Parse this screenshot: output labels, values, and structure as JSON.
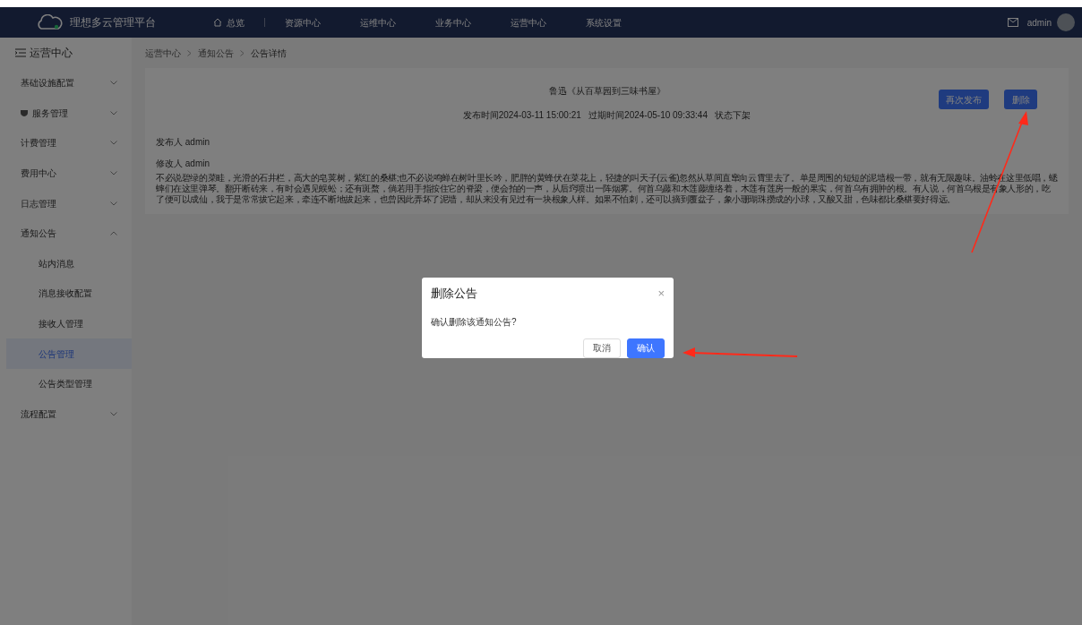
{
  "header": {
    "brand": "理想多云管理平台",
    "nav": [
      {
        "label": "总览",
        "kind": "home"
      },
      {
        "label": "资源中心",
        "kind": "plain"
      },
      {
        "label": "运维中心",
        "kind": "plain"
      },
      {
        "label": "业务中心",
        "kind": "plain"
      },
      {
        "label": "运营中心",
        "kind": "plain"
      },
      {
        "label": "系统设置",
        "kind": "plain"
      }
    ],
    "user": "admin"
  },
  "sidebar": {
    "title": "运营中心",
    "items": [
      {
        "label": "基础设施配置",
        "expanded": false
      },
      {
        "label": "服务管理",
        "expanded": false
      },
      {
        "label": "计费管理",
        "expanded": false
      },
      {
        "label": "费用中心",
        "expanded": false
      },
      {
        "label": "日志管理",
        "expanded": false
      },
      {
        "label": "通知公告",
        "expanded": true,
        "children": [
          {
            "label": "站内消息",
            "selected": false
          },
          {
            "label": "消息接收配置",
            "selected": false
          },
          {
            "label": "接收人管理",
            "selected": false
          },
          {
            "label": "公告管理",
            "selected": true
          },
          {
            "label": "公告类型管理",
            "selected": false
          }
        ]
      },
      {
        "label": "流程配置",
        "expanded": false
      }
    ]
  },
  "breadcrumb": [
    "运营中心",
    "通知公告",
    "公告详情"
  ],
  "notice": {
    "title": "鲁迅《从百草园到三味书屋》",
    "meta": "发布时间2024-03-11 15:00:21   过期时间2024-05-10 09:33:44   状态下架",
    "publisher": "发布人 admin",
    "modifier": "修改人 admin",
    "body": "不必说碧绿的菜畦，光滑的石井栏，高大的皂荚树，紫红的桑椹;也不必说鸣蝉在树叶里长吟，肥胖的黄蜂伏在菜花上，轻捷的叫天子(云雀)忽然从草间直窜向云霄里去了。单是周围的短短的泥墙根一带，就有无限趣味。油蛉在这里低唱，蟋蟀们在这里弹琴。翻开断砖来，有时会遇见蜈蚣；还有斑蝥，倘若用手指按住它的脊梁，便会拍的一声，从后窍喷出一阵烟雾。何首乌藤和木莲藤缠络着，木莲有莲房一般的果实，何首乌有拥肿的根。有人说，何首乌根是有象人形的，吃了便可以成仙，我于是常常拔它起来，牵连不断地拔起来，也曾因此弄坏了泥墙，却从来没有见过有一块根象人样。如果不怕刺，还可以摘到覆盆子，象小珊瑚珠攒成的小球，又酸又甜，色味都比桑椹要好得远。",
    "buttons": [
      "再次发布",
      "删除"
    ]
  },
  "dialog": {
    "title": "删除公告",
    "close": "×",
    "message": "确认删除该通知公告?",
    "buttons": [
      {
        "label": "取消",
        "kind": "secondary"
      },
      {
        "label": "确认",
        "kind": "primary"
      }
    ]
  }
}
